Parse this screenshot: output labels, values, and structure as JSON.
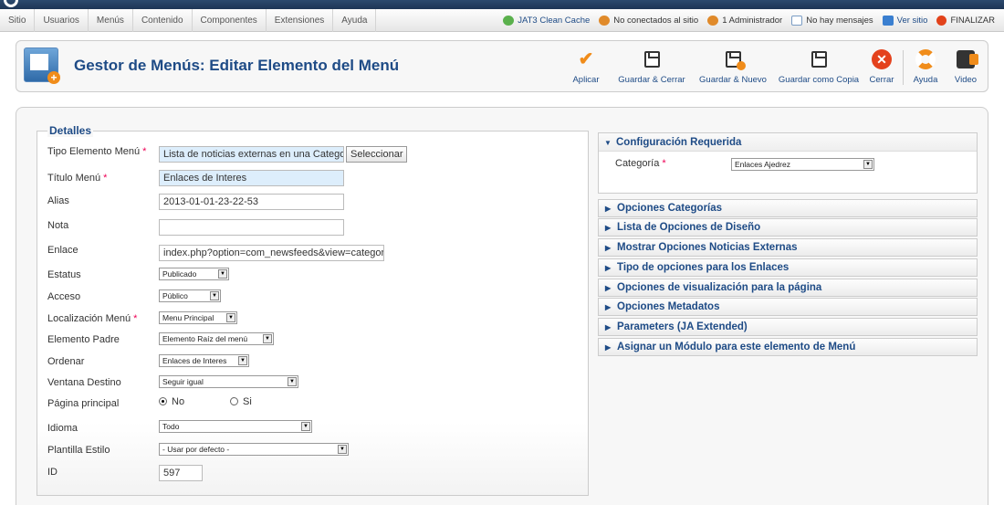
{
  "menubar": {
    "items": [
      "Sitio",
      "Usuarios",
      "Menús",
      "Contenido",
      "Componentes",
      "Extensiones",
      "Ayuda"
    ],
    "status": [
      {
        "label": "JAT3 Clean Cache",
        "icon": "recycle-icon"
      },
      {
        "label": "No conectados al sitio",
        "icon": "user-offline-icon"
      },
      {
        "label": "1 Administrador",
        "icon": "user-admin-icon"
      },
      {
        "label": "No hay mensajes",
        "icon": "mail-icon"
      },
      {
        "label": "Ver sitio",
        "icon": "monitor-icon"
      },
      {
        "label": "FINALIZAR",
        "icon": "power-icon"
      }
    ]
  },
  "toolbar": {
    "title": "Gestor de Menús: Editar Elemento del Menú",
    "buttons": {
      "aplicar": "Aplicar",
      "guardar_cerrar": "Guardar & Cerrar",
      "guardar_nuevo": "Guardar & Nuevo",
      "guardar_copia": "Guardar como Copia",
      "cerrar": "Cerrar",
      "ayuda": "Ayuda",
      "video": "Video"
    }
  },
  "details": {
    "legend": "Detalles",
    "tipo_label": "Tipo Elemento Menú",
    "tipo_value": "Lista de noticias externas en una Categoría",
    "select_button": "Seleccionar",
    "titulo_label": "Título Menú",
    "titulo_value": "Enlaces de Interes",
    "alias_label": "Alias",
    "alias_value": "2013-01-01-23-22-53",
    "nota_label": "Nota",
    "nota_value": "",
    "enlace_label": "Enlace",
    "enlace_value": "index.php?option=com_newsfeeds&view=category",
    "estatus_label": "Estatus",
    "estatus_value": "Publicado",
    "acceso_label": "Acceso",
    "acceso_value": "Público",
    "localizacion_label": "Localización Menú",
    "localizacion_value": "Menu Principal",
    "padre_label": "Elemento Padre",
    "padre_value": "Elemento Raíz del menú",
    "ordenar_label": "Ordenar",
    "ordenar_value": "Enlaces de Interes",
    "ventana_label": "Ventana Destino",
    "ventana_value": "Seguir igual",
    "principal_label": "Página principal",
    "principal_no": "No",
    "principal_si": "Si",
    "idioma_label": "Idioma",
    "idioma_value": "Todo",
    "plantilla_label": "Plantilla Estilo",
    "plantilla_value": "- Usar por defecto -",
    "id_label": "ID",
    "id_value": "597"
  },
  "right": {
    "config_header": "Configuración Requerida",
    "categoria_label": "Categoría",
    "categoria_value": "Enlaces Ajedrez",
    "sections": [
      "Opciones Categorías",
      "Lista de Opciones de Diseño",
      "Mostrar Opciones Noticias Externas",
      "Tipo de opciones para los Enlaces",
      "Opciones de visualización para la página",
      "Opciones Metadatos",
      "Parameters (JA Extended)",
      "Asignar un Módulo para este elemento de Menú"
    ]
  },
  "colors": {
    "accent": "#1e4b86",
    "required": "#ee0055",
    "orange": "#f08c1a"
  }
}
